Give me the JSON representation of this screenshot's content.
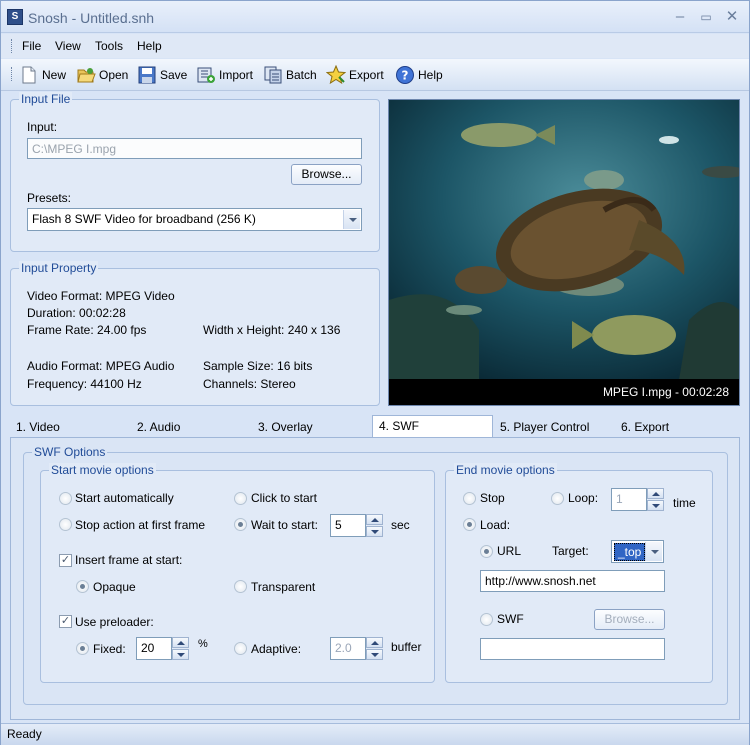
{
  "window": {
    "title": "Snosh - Untitled.snh",
    "app_icon_text": "S"
  },
  "menu": [
    "File",
    "View",
    "Tools",
    "Help"
  ],
  "toolbar": [
    {
      "label": "New",
      "icon": "new-document-icon"
    },
    {
      "label": "Open",
      "icon": "open-folder-icon"
    },
    {
      "label": "Save",
      "icon": "save-icon"
    },
    {
      "label": "Import",
      "icon": "import-icon"
    },
    {
      "label": "Batch",
      "icon": "batch-icon"
    },
    {
      "label": "Export",
      "icon": "export-icon"
    },
    {
      "label": "Help",
      "icon": "help-icon"
    }
  ],
  "input_file": {
    "group_label": "Input File",
    "input_label": "Input:",
    "input_value": "C:\\MPEG I.mpg",
    "browse_label": "Browse...",
    "presets_label": "Presets:",
    "preset_value": "Flash 8 SWF Video for broadband (256 K)"
  },
  "input_property": {
    "group_label": "Input Property",
    "video_format": "Video Format: MPEG Video",
    "duration": "Duration: 00:02:28",
    "frame_rate": "Frame Rate: 24.00 fps",
    "dimensions": "Width x Height: 240 x 136",
    "audio_format": "Audio Format: MPEG Audio",
    "sample_size": "Sample Size: 16 bits",
    "frequency": "Frequency: 44100 Hz",
    "channels": "Channels: Stereo"
  },
  "preview": {
    "caption": "MPEG I.mpg - 00:02:28"
  },
  "tabs": [
    "1. Video",
    "2. Audio",
    "3. Overlay",
    "4. SWF",
    "5. Player Control",
    "6. Export"
  ],
  "active_tab": "4. SWF",
  "swf": {
    "group_label": "SWF Options",
    "start": {
      "group_label": "Start movie options",
      "start_auto": "Start automatically",
      "click_start": "Click to start",
      "stop_first": "Stop action at first frame",
      "wait_start": "Wait to start:",
      "wait_value": "5",
      "wait_unit": "sec",
      "insert_frame": "Insert frame at start:",
      "opaque": "Opaque",
      "transparent": "Transparent",
      "use_preloader": "Use preloader:",
      "fixed": "Fixed:",
      "fixed_value": "20",
      "fixed_unit": "%",
      "adaptive": "Adaptive:",
      "adaptive_value": "2.0",
      "adaptive_unit": "buffer"
    },
    "end": {
      "group_label": "End movie options",
      "stop": "Stop",
      "loop": "Loop:",
      "loop_value": "1",
      "loop_unit": "time",
      "load": "Load:",
      "url": "URL",
      "target_label": "Target:",
      "target_value": "_top",
      "url_value": "http://www.snosh.net",
      "swf": "SWF",
      "browse_label": "Browse...",
      "swf_value": ""
    }
  },
  "status": "Ready"
}
